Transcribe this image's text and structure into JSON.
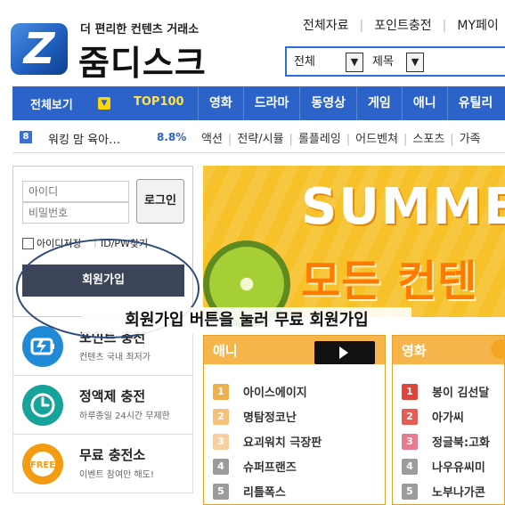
{
  "header": {
    "tagline": "더 편리한 컨텐츠 거래소",
    "brand": "줌디스크",
    "logo_letter": "Z",
    "top_links": [
      "전체자료",
      "포인트충전",
      "MY페이"
    ],
    "search": {
      "select1": {
        "selected": "전체"
      },
      "select2": {
        "selected": "제목"
      }
    }
  },
  "nav": {
    "all_view": "전체보기",
    "top100": "TOP100",
    "categories": [
      "영화",
      "드라마",
      "동영상",
      "게임",
      "애니",
      "유틸리"
    ]
  },
  "rank_strip": {
    "rank": "8",
    "title": "워킹 맘 육아…",
    "pct": "8.8%",
    "genres": [
      "액션",
      "전략/시뮬",
      "롤플레잉",
      "어드벤쳐",
      "스포츠",
      "가족"
    ]
  },
  "login": {
    "id_placeholder": "아이디",
    "pw_placeholder": "비밀번호",
    "login_button": "로그인",
    "remember_id": "아이디저장",
    "separator": "|",
    "find_id_pw": "ID/PW찾기",
    "join_button": "회원가입"
  },
  "annotation": {
    "text": "회원가입 버튼을 눌러 무료 회원가입"
  },
  "services": [
    {
      "title": "포인트 충전",
      "desc": "컨텐츠 국내 최저가",
      "icon": "battery-icon",
      "color": "#1f8ad6"
    },
    {
      "title": "정액제 충전",
      "desc": "하루종일 24시간 무제한",
      "icon": "clock-icon",
      "color": "#16a39a"
    },
    {
      "title": "무료 충전소",
      "desc": "이벤트 참여만 해도!",
      "icon": "free-badge-icon",
      "color": "#f39c12"
    }
  ],
  "banner": {
    "headline": "SUMME",
    "subline": "모든 컨텐"
  },
  "lists": {
    "anime": {
      "title": "애니",
      "items": [
        {
          "rank": "1",
          "title": "아이스에이지"
        },
        {
          "rank": "2",
          "title": "명탐정코난"
        },
        {
          "rank": "3",
          "title": "요괴워치 극장판"
        },
        {
          "rank": "4",
          "title": "슈퍼프랜즈"
        },
        {
          "rank": "5",
          "title": "리틀폭스"
        }
      ]
    },
    "movie": {
      "title": "영화",
      "items": [
        {
          "rank": "1",
          "title": "봉이 김선달"
        },
        {
          "rank": "2",
          "title": "아가씨"
        },
        {
          "rank": "3",
          "title": "정글북:고화"
        },
        {
          "rank": "4",
          "title": "나우유씨미"
        },
        {
          "rank": "5",
          "title": "노부나가콘"
        }
      ]
    }
  },
  "colors": {
    "brand_blue": "#2b63c9",
    "orange_head": "#f6b54a",
    "rank_badge_top": "#f0b14d",
    "rank_badge_red": "#e0443b",
    "rank_badge_gray": "#9c9c9c"
  }
}
